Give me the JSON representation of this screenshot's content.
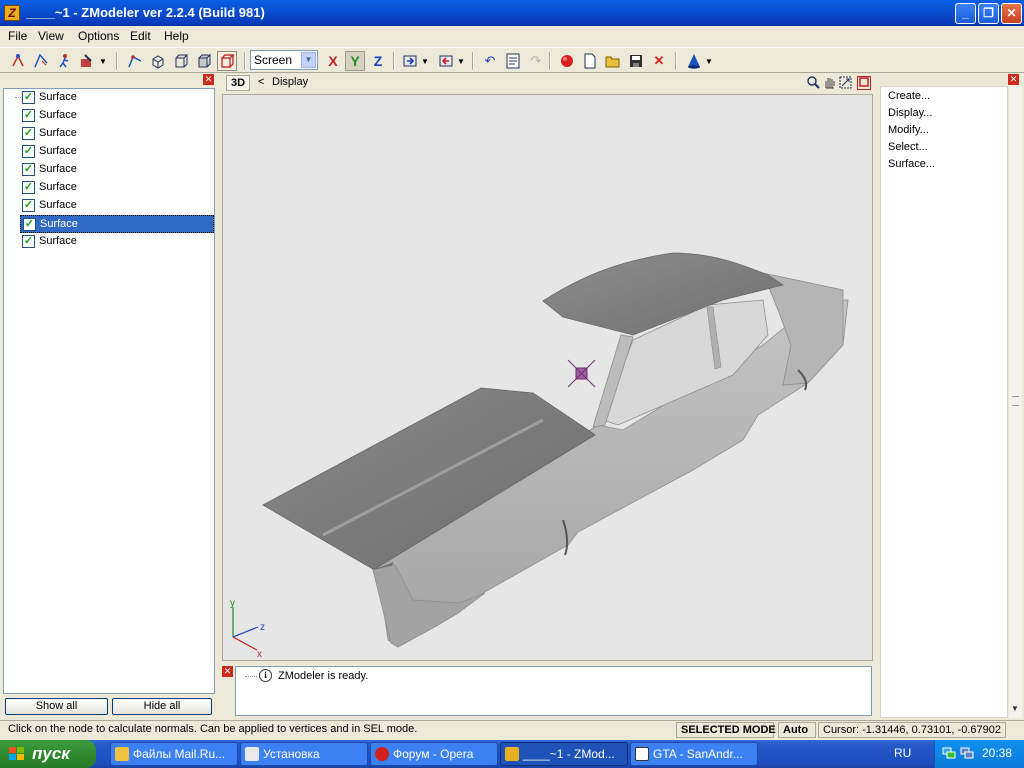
{
  "window": {
    "title": "____~1 - ZModeler ver 2.2.4 (Build 981)",
    "icon_letter": "Z"
  },
  "menu": [
    {
      "label": "File"
    },
    {
      "label": "View"
    },
    {
      "label": "Options"
    },
    {
      "label": "Edit"
    },
    {
      "label": "Help"
    }
  ],
  "toolbar": {
    "mode_select": "Screen",
    "axis_x": "X",
    "axis_y": "Y",
    "axis_z": "Z"
  },
  "left_panel": {
    "items": [
      {
        "label": "Surface",
        "checked": true
      },
      {
        "label": "Surface",
        "checked": true
      },
      {
        "label": "Surface",
        "checked": true
      },
      {
        "label": "Surface",
        "checked": true
      },
      {
        "label": "Surface",
        "checked": true
      },
      {
        "label": "Surface",
        "checked": true
      },
      {
        "label": "Surface",
        "checked": true
      },
      {
        "label": "Surface",
        "checked": true,
        "selected": true
      },
      {
        "label": "Surface",
        "checked": true
      }
    ],
    "show_all": "Show all",
    "hide_all": "Hide all"
  },
  "viewport": {
    "mode": "3D",
    "back": "<",
    "breadcrumb": "Display",
    "axis_y": "y",
    "axis_z": "z",
    "axis_x": "x"
  },
  "right_panel": {
    "items": [
      {
        "label": "Create..."
      },
      {
        "label": "Display..."
      },
      {
        "label": "Modify..."
      },
      {
        "label": "Select..."
      },
      {
        "label": "Surface..."
      }
    ]
  },
  "log": {
    "icon": "i",
    "message": "ZModeler is ready."
  },
  "status": {
    "hint": "Click on the node to calculate normals. Can be applied to vertices and in SEL mode.",
    "mode": "SELECTED MODE",
    "snap": "Auto",
    "cursor": "Cursor: -1.31446, 0.73101, -0.67902"
  },
  "taskbar": {
    "start": "пуск",
    "tasks": [
      {
        "label": "Файлы Mail.Ru..."
      },
      {
        "label": "Установка"
      },
      {
        "label": "Форум - Opera"
      },
      {
        "label": "____~1 - ZMod..."
      },
      {
        "label": "GTA - SanAndr..."
      }
    ],
    "lang": "RU",
    "clock": "20:38"
  },
  "colors": {
    "titlebar": "#0a4fd0",
    "selection": "#316ac5",
    "viewport_bg": "#e6e6e6",
    "taskbar": "#245edb",
    "start": "#2f8a2f"
  }
}
